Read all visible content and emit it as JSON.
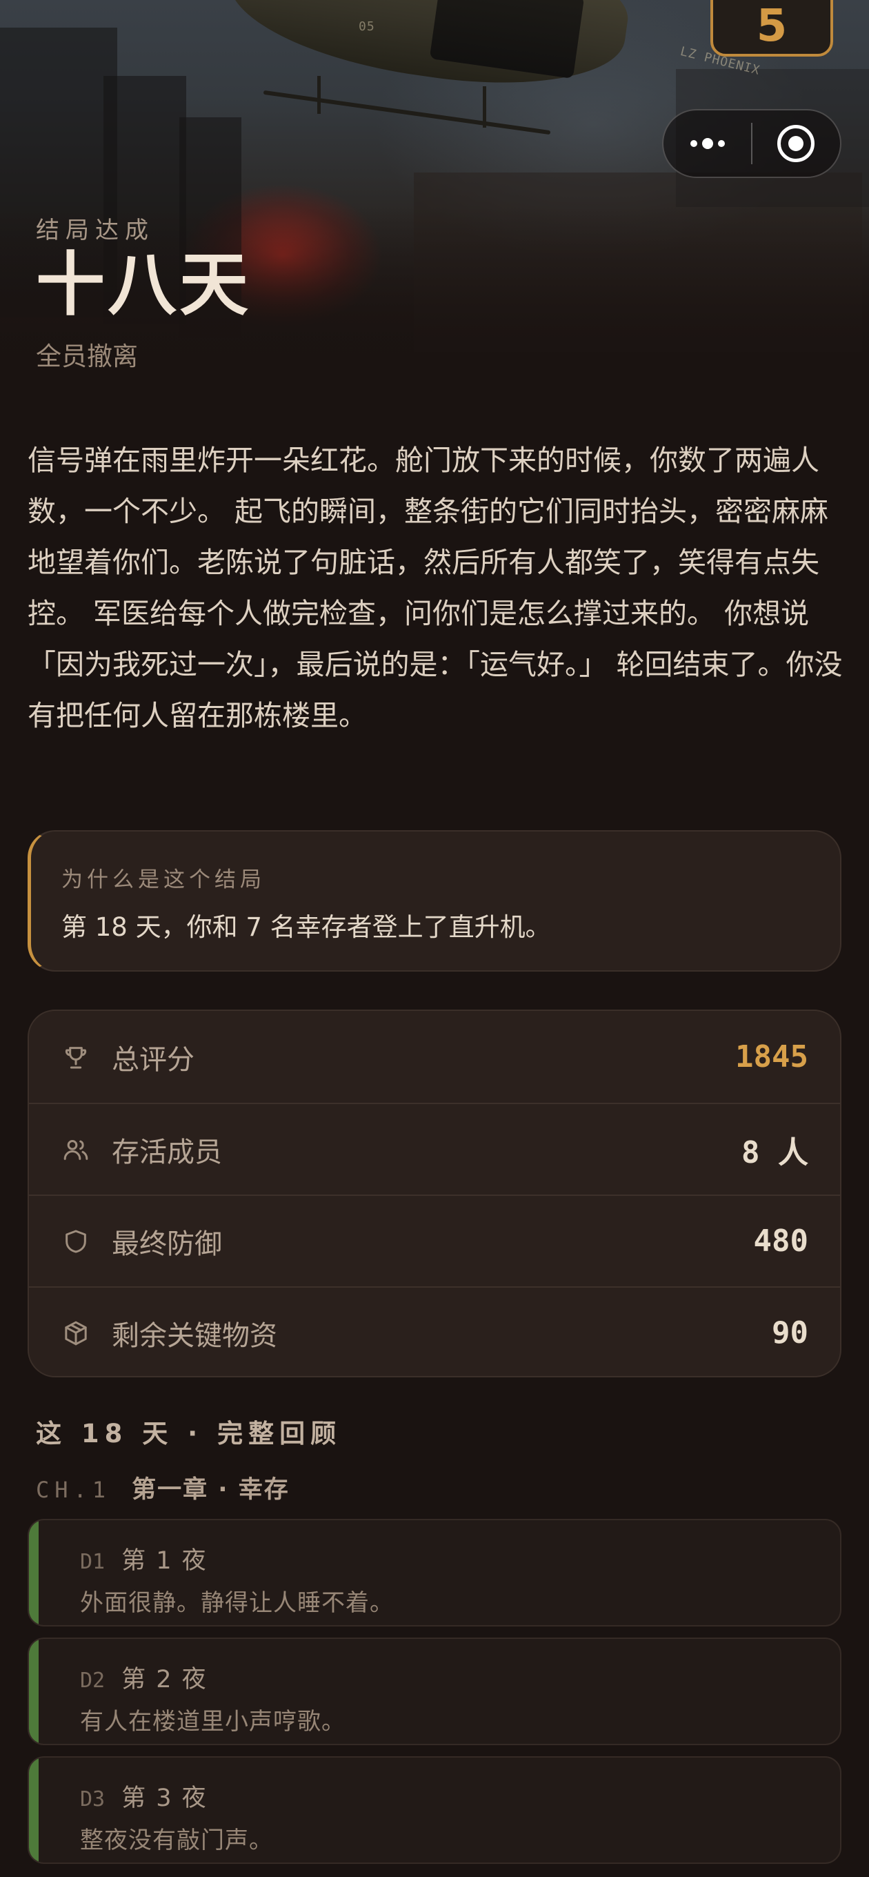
{
  "header": {
    "score_badge": "5"
  },
  "capsule": {
    "more_icon": "more-dots-icon",
    "close_icon": "target-close-icon"
  },
  "ending": {
    "label": "结局达成",
    "title": "十八天",
    "subtitle": "全员撤离"
  },
  "narrative": "信号弹在雨里炸开一朵红花。舱门放下来的时候，你数了两遍人数，一个不少。 起飞的瞬间，整条街的它们同时抬头，密密麻麻地望着你们。老陈说了句脏话，然后所有人都笑了，笑得有点失控。 军医给每个人做完检查，问你们是怎么撑过来的。 你想说「因为我死过一次」，最后说的是：「运气好。」 轮回结束了。你没有把任何人留在那栋楼里。",
  "why": {
    "label": "为什么是这个结局",
    "text": "第 18 天，你和 7 名幸存者登上了直升机。"
  },
  "stats": [
    {
      "icon": "trophy-icon",
      "label": "总评分",
      "value": "1845",
      "accent": "#d8a04a"
    },
    {
      "icon": "users-icon",
      "label": "存活成员",
      "value": "8 人"
    },
    {
      "icon": "shield-icon",
      "label": "最终防御",
      "value": "480"
    },
    {
      "icon": "box-icon",
      "label": "剩余关键物资",
      "value": "90"
    }
  ],
  "recap": {
    "title": "这 18 天 · 完整回顾",
    "chapter": {
      "code": "CH.1",
      "name": "第一章 · 幸存"
    },
    "days": [
      {
        "code": "D1",
        "name": "第 1 夜",
        "text": "外面很静。静得让人睡不着。"
      },
      {
        "code": "D2",
        "name": "第 2 夜",
        "text": "有人在楼道里小声哼歌。"
      },
      {
        "code": "D3",
        "name": "第 3 夜",
        "text": "整夜没有敲门声。"
      }
    ]
  },
  "colors": {
    "background": "#1a1311",
    "accent_gold": "#c7913f",
    "day_bar_green": "#4e7a3a"
  }
}
